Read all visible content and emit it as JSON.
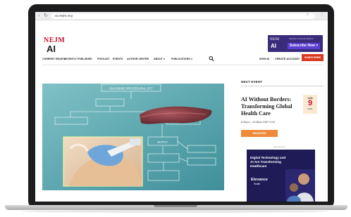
{
  "browser": {
    "url": "ai.nejm.org"
  },
  "site": {
    "logo_top": "NEJM",
    "logo_bottom": "AI"
  },
  "top_ad": {
    "logo_top": "NEJM",
    "logo_bottom": "AI",
    "note": "Monthly & Annual Options",
    "cta": "Subscribe Now >"
  },
  "nav": {
    "items": [
      "CURRENT ISSUE ∨",
      "RECENTLY PUBLISHED",
      "PODCAST",
      "EVENTS",
      "AUTHOR CENTER",
      "ABOUT ∨",
      "PUBLICATIONS ∨"
    ],
    "signin": "SIGN IN",
    "create_account": "CREATE ACCOUNT",
    "subscribe": "SUBSCRIBE"
  },
  "hero": {
    "diagram_label": "DIAGNOSE PROCEDURAL EFT",
    "box_label": "BIOPSY"
  },
  "event": {
    "section_title": "NEXT EVENT",
    "title": "AI Without Borders: Transforming Global Health Care",
    "time": "8:30pm – 10:45pm GMT+3:30",
    "date_month": "JUN",
    "date_day": "9",
    "date_year": "2025",
    "register": "REGISTER"
  },
  "side_ad": {
    "label": "Advertisement",
    "headline": "Digital Technology and AI Are Transforming Healthcare",
    "brand_line1": "Elevance",
    "brand_line2": "Health"
  },
  "colors": {
    "accent": "#c8102e",
    "subscribe": "#d9381e",
    "register": "#ee8a3a",
    "ad_bg": "#3a2c7a",
    "hero_bg": "#5fa9b2"
  }
}
